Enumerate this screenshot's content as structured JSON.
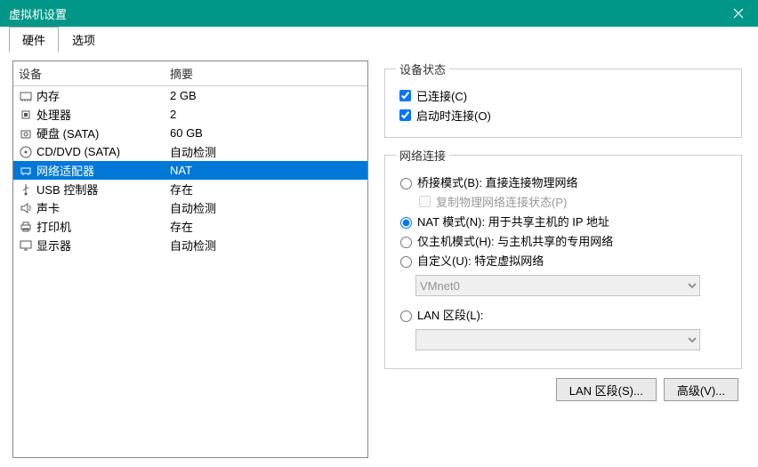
{
  "window": {
    "title": "虚拟机设置"
  },
  "tabs": {
    "hardware": "硬件",
    "options": "选项"
  },
  "columns": {
    "device": "设备",
    "summary": "摘要"
  },
  "devices": [
    {
      "icon": "memory",
      "name": "内存",
      "summary": "2 GB"
    },
    {
      "icon": "cpu",
      "name": "处理器",
      "summary": "2"
    },
    {
      "icon": "disk",
      "name": "硬盘 (SATA)",
      "summary": "60 GB"
    },
    {
      "icon": "cd",
      "name": "CD/DVD (SATA)",
      "summary": "自动检测"
    },
    {
      "icon": "net",
      "name": "网络适配器",
      "summary": "NAT",
      "selected": true
    },
    {
      "icon": "usb",
      "name": "USB 控制器",
      "summary": "存在"
    },
    {
      "icon": "sound",
      "name": "声卡",
      "summary": "自动检测"
    },
    {
      "icon": "printer",
      "name": "打印机",
      "summary": "存在"
    },
    {
      "icon": "display",
      "name": "显示器",
      "summary": "自动检测"
    }
  ],
  "device_status": {
    "legend": "设备状态",
    "connected": "已连接(C)",
    "connect_on_power": "启动时连接(O)"
  },
  "network": {
    "legend": "网络连接",
    "bridged": "桥接模式(B): 直接连接物理网络",
    "replicate": "复制物理网络连接状态(P)",
    "nat": "NAT 模式(N): 用于共享主机的 IP 地址",
    "hostonly": "仅主机模式(H): 与主机共享的专用网络",
    "custom": "自定义(U): 特定虚拟网络",
    "custom_value": "VMnet0",
    "lan": "LAN 区段(L):",
    "lan_value": ""
  },
  "buttons": {
    "lan_segments": "LAN 区段(S)...",
    "advanced": "高级(V)..."
  }
}
